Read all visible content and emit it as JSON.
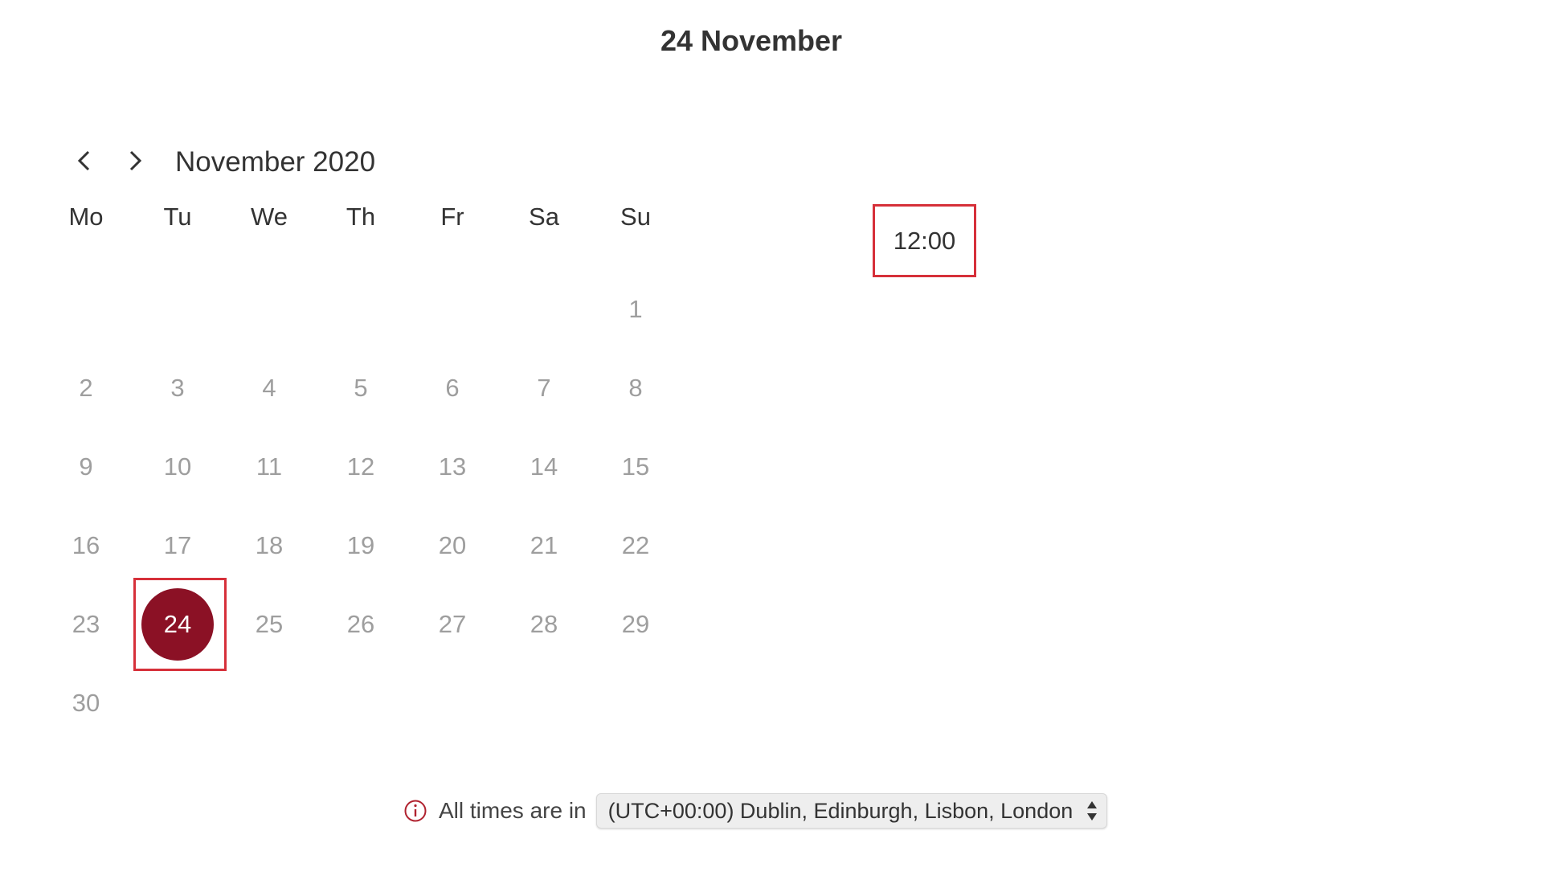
{
  "header": {
    "title": "24 November"
  },
  "calendar": {
    "month_label": "November 2020",
    "weekdays": [
      "Mo",
      "Tu",
      "We",
      "Th",
      "Fr",
      "Sa",
      "Su"
    ],
    "weeks": [
      [
        "",
        "",
        "",
        "",
        "",
        "",
        "1"
      ],
      [
        "2",
        "3",
        "4",
        "5",
        "6",
        "7",
        "8"
      ],
      [
        "9",
        "10",
        "11",
        "12",
        "13",
        "14",
        "15"
      ],
      [
        "16",
        "17",
        "18",
        "19",
        "20",
        "21",
        "22"
      ],
      [
        "23",
        "24",
        "25",
        "26",
        "27",
        "28",
        "29"
      ],
      [
        "30",
        "",
        "",
        "",
        "",
        "",
        ""
      ]
    ],
    "selected_day": "24"
  },
  "time_slots": [
    "12:00"
  ],
  "timezone": {
    "prefix": "All times are in",
    "selected": "(UTC+00:00) Dublin, Edinburgh, Lisbon, London"
  },
  "colors": {
    "accent": "#8b1125",
    "highlight_border": "#d6303a"
  },
  "icons": {
    "prev": "chevron-left-icon",
    "next": "chevron-right-icon",
    "info": "info-icon",
    "select": "sort-arrows-icon"
  }
}
